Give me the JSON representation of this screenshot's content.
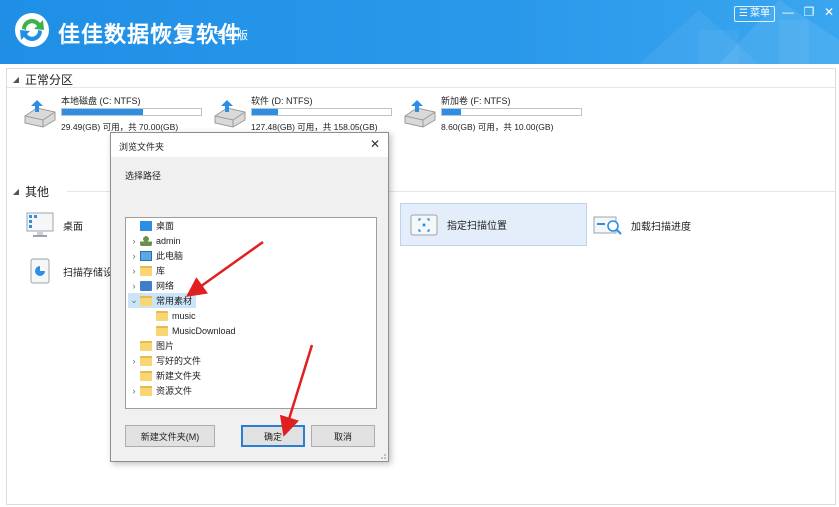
{
  "app": {
    "title": "佳佳数据恢复软件",
    "edition": "专业版",
    "menu_label": "菜单",
    "brand_color": "#2a98ea"
  },
  "window_controls": {
    "minimize": "—",
    "restore": "❐",
    "close": "✕"
  },
  "sections": {
    "partitions_label": "正常分区",
    "other_label": "其他"
  },
  "disks": [
    {
      "name": "本地磁盘 (C: NTFS)",
      "size": "29.49(GB) 可用，共 70.00(GB)",
      "used_fraction": 0.58
    },
    {
      "name": "软件 (D: NTFS)",
      "size": "127.48(GB) 可用，共 158.05(GB)",
      "used_fraction": 0.19
    },
    {
      "name": "新加卷 (F: NTFS)",
      "size": "8.60(GB) 可用，共 10.00(GB)",
      "used_fraction": 0.14
    }
  ],
  "tools": {
    "desktop": "桌面",
    "specify_location": "指定扫描位置",
    "load_progress": "加载扫描进度",
    "scan_storage": "扫描存储设备"
  },
  "dialog": {
    "title": "浏览文件夹",
    "close": "✕",
    "prompt": "选择路径",
    "tree": [
      {
        "label": "桌面",
        "expander": "",
        "icon": "desktop-icon"
      },
      {
        "label": "admin",
        "expander": "›",
        "icon": "user-icon"
      },
      {
        "label": "此电脑",
        "expander": "›",
        "icon": "computer-icon"
      },
      {
        "label": "库",
        "expander": "›",
        "icon": "library-icon"
      },
      {
        "label": "网络",
        "expander": "›",
        "icon": "network-icon"
      },
      {
        "label": "常用素材",
        "expander": "⌄",
        "icon": "folder-icon"
      },
      {
        "label": "music",
        "expander": "",
        "icon": "folder-icon"
      },
      {
        "label": "MusicDownload",
        "expander": "",
        "icon": "folder-icon"
      },
      {
        "label": "图片",
        "expander": "",
        "icon": "folder-icon"
      },
      {
        "label": "写好的文件",
        "expander": "›",
        "icon": "folder-icon"
      },
      {
        "label": "新建文件夹",
        "expander": "",
        "icon": "folder-icon"
      },
      {
        "label": "资源文件",
        "expander": "›",
        "icon": "folder-icon"
      }
    ],
    "new_folder_button": "新建文件夹(M)",
    "ok_button": "确定",
    "cancel_button": "取消"
  },
  "annotation_color": "#e02020"
}
